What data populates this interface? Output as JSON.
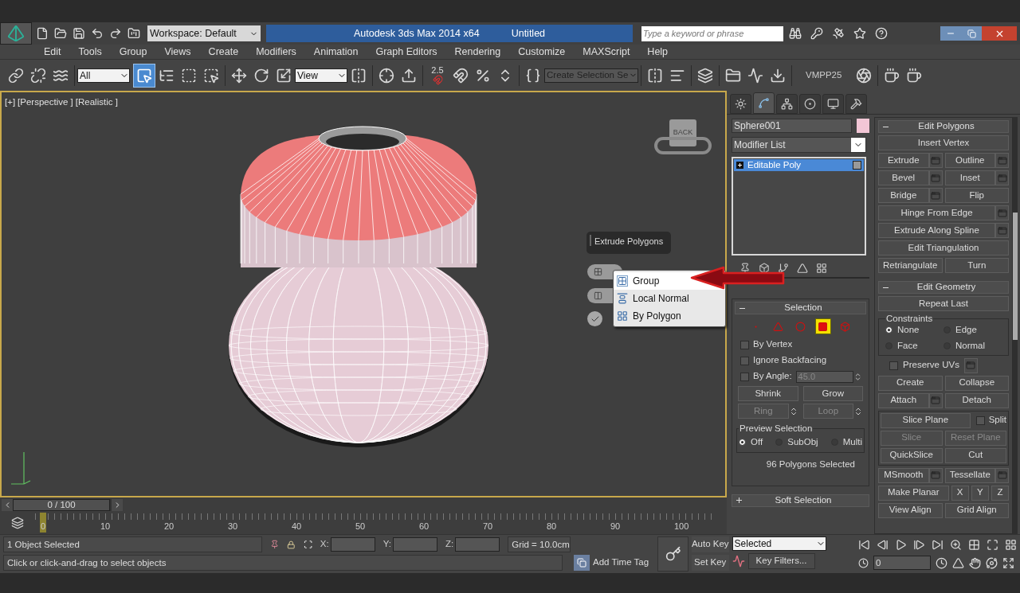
{
  "title_bar": {
    "workspace": "Workspace: Default",
    "app_title": "Autodesk 3ds Max  2014 x64",
    "document": "Untitled",
    "search_placeholder": "Type a keyword or phrase"
  },
  "menu": [
    "Edit",
    "Tools",
    "Group",
    "Views",
    "Create",
    "Modifiers",
    "Animation",
    "Graph Editors",
    "Rendering",
    "Customize",
    "MAXScript",
    "Help"
  ],
  "toolbar": {
    "selection_filter": "All",
    "select_object": {
      "selected": true
    },
    "reference_coordinate": "View",
    "angle_snap": "2.5",
    "named_selection": "Create Selection Se",
    "render_preset": "VMPP25"
  },
  "viewport": {
    "labels": [
      "[+]",
      "[Perspective ]",
      "[Realistic ]"
    ],
    "viewcube": "BACK",
    "active": true
  },
  "caddy": {
    "title": "Extrude Polygons",
    "menu": [
      {
        "label": "Group",
        "selected": true
      },
      {
        "label": "Local Normal",
        "selected": false
      },
      {
        "label": "By Polygon",
        "selected": false
      }
    ]
  },
  "command_panel": {
    "tabs": [
      {
        "kind": "create",
        "selected": false
      },
      {
        "kind": "modify",
        "selected": true
      },
      {
        "kind": "hierarchy",
        "selected": false
      },
      {
        "kind": "motion",
        "selected": false
      },
      {
        "kind": "display",
        "selected": false
      },
      {
        "kind": "utilities",
        "selected": false
      }
    ],
    "object_name": "Sphere001",
    "color": "#f2c6d6",
    "modifier_list": "Modifier List",
    "stack": [
      {
        "label": "Editable Poly",
        "selected": true
      }
    ],
    "selection": {
      "title": "Selection",
      "expanded": true,
      "levels": [
        {
          "kind": "vertex",
          "selected": false
        },
        {
          "kind": "edge",
          "selected": false
        },
        {
          "kind": "border",
          "selected": false
        },
        {
          "kind": "polygon",
          "selected": true
        },
        {
          "kind": "element",
          "selected": false
        }
      ],
      "options": [
        {
          "label": "By Vertex",
          "checked": false
        },
        {
          "label": "Ignore Backfacing",
          "checked": false
        },
        {
          "label": "By Angle:",
          "checked": false
        }
      ],
      "angle": "45.0",
      "buttons": [
        {
          "label": "Shrink",
          "disabled": false,
          "spinner": false
        },
        {
          "label": "Grow",
          "disabled": false,
          "spinner": false
        },
        {
          "label": "Ring",
          "disabled": true,
          "spinner": true
        },
        {
          "label": "Loop",
          "disabled": true,
          "spinner": true
        }
      ],
      "preview_title": "Preview Selection",
      "preview": [
        {
          "label": "Off",
          "selected": true
        },
        {
          "label": "SubObj",
          "selected": false
        },
        {
          "label": "Multi",
          "selected": false
        }
      ],
      "status": "96 Polygons Selected"
    },
    "soft_selection": {
      "title": "Soft Selection",
      "expanded": false
    },
    "edit_polygons": {
      "title": "Edit Polygons",
      "expanded": true,
      "rows": [
        [
          {
            "label": "Insert Vertex",
            "settings": false
          }
        ],
        [
          {
            "label": "Extrude",
            "settings": true
          },
          {
            "label": "Outline",
            "settings": true
          }
        ],
        [
          {
            "label": "Bevel",
            "settings": true
          },
          {
            "label": "Inset",
            "settings": true
          }
        ],
        [
          {
            "label": "Bridge",
            "settings": true
          },
          {
            "label": "Flip",
            "settings": false
          }
        ],
        [
          {
            "label": "Hinge From Edge",
            "settings": true
          }
        ],
        [
          {
            "label": "Extrude Along Spline",
            "settings": true
          }
        ],
        [
          {
            "label": "Edit Triangulation",
            "settings": false
          }
        ],
        [
          {
            "label": "Retriangulate",
            "settings": false
          },
          {
            "label": "Turn",
            "settings": false
          }
        ]
      ]
    },
    "edit_geometry": {
      "title": "Edit Geometry",
      "expanded": true,
      "repeat_last": "Repeat Last",
      "constraints_title": "Constraints",
      "constraints": [
        {
          "label": "None",
          "selected": true
        },
        {
          "label": "Edge",
          "selected": false
        },
        {
          "label": "Face",
          "selected": false
        },
        {
          "label": "Normal",
          "selected": false
        }
      ],
      "preserve_uvs": {
        "label": "Preserve UVs",
        "checked": false
      },
      "rows": [
        [
          {
            "kind": "button",
            "label": "Create",
            "settings": false,
            "disabled": false
          },
          {
            "kind": "button",
            "label": "Collapse",
            "settings": false,
            "disabled": false
          }
        ],
        [
          {
            "kind": "button",
            "label": "Attach",
            "settings": true,
            "disabled": false
          },
          {
            "kind": "button",
            "label": "Detach",
            "settings": false,
            "disabled": false
          }
        ]
      ],
      "slice_rows": [
        [
          {
            "kind": "button",
            "label": "Slice Plane",
            "settings": false,
            "disabled": false
          },
          {
            "kind": "checkbox",
            "label": "Split",
            "checked": false
          }
        ],
        [
          {
            "kind": "button",
            "label": "Slice",
            "settings": false,
            "disabled": true
          },
          {
            "kind": "button",
            "label": "Reset Plane",
            "settings": false,
            "disabled": true
          }
        ],
        [
          {
            "kind": "button",
            "label": "QuickSlice",
            "settings": false,
            "disabled": false
          },
          {
            "kind": "button",
            "label": "Cut",
            "settings": false,
            "disabled": false
          }
        ]
      ],
      "more_rows": [
        [
          {
            "kind": "button",
            "label": "MSmooth",
            "settings": true,
            "disabled": false
          },
          {
            "kind": "button",
            "label": "Tessellate",
            "settings": true,
            "disabled": false
          }
        ],
        [
          {
            "kind": "button",
            "label": "Make Planar",
            "settings": false,
            "disabled": false
          },
          {
            "kind": "button",
            "label": "X",
            "settings": false,
            "disabled": false
          },
          {
            "kind": "button",
            "label": "Y",
            "settings": false,
            "disabled": false
          },
          {
            "kind": "button",
            "label": "Z",
            "settings": false,
            "disabled": false
          }
        ],
        [
          {
            "kind": "button",
            "label": "View Align",
            "settings": false,
            "disabled": false
          },
          {
            "kind": "button",
            "label": "Grid Align",
            "settings": false,
            "disabled": false
          }
        ]
      ]
    }
  },
  "time_slider": {
    "label": "0 / 100",
    "level": 0
  },
  "track_bar": {
    "ticks": [
      "0",
      "10",
      "20",
      "30",
      "40",
      "50",
      "60",
      "70",
      "80",
      "90",
      "100"
    ]
  },
  "status": {
    "selection": "1 Object Selected",
    "prompt": "Click or click-and-drag to select objects",
    "x_label": "X:",
    "y_label": "Y:",
    "z_label": "Z:",
    "grid": "Grid = 10.0cm",
    "time_tag": "Add Time Tag"
  },
  "animation": {
    "auto_key": "Auto Key",
    "set_key": "Set Key",
    "key_mode": "Selected",
    "key_filters": "Key Filters...",
    "frame": "0"
  }
}
